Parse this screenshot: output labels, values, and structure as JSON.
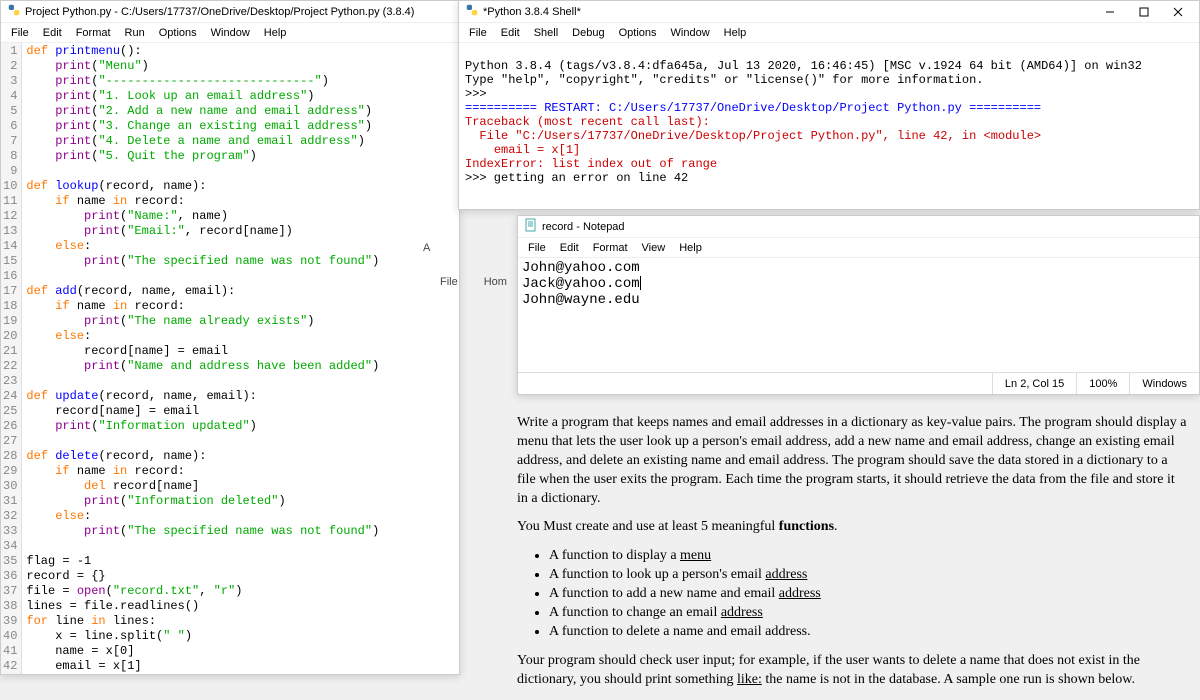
{
  "editor": {
    "title": "Project Python.py - C:/Users/17737/OneDrive/Desktop/Project Python.py (3.8.4)",
    "menu": [
      "File",
      "Edit",
      "Format",
      "Run",
      "Options",
      "Window",
      "Help"
    ],
    "code_lines": [
      {
        "n": 1,
        "tok": [
          [
            "kw",
            "def "
          ],
          [
            "def",
            "printmenu"
          ],
          [
            "",
            "():"
          ]
        ]
      },
      {
        "n": 2,
        "tok": [
          [
            "",
            "    "
          ],
          [
            "builtin",
            "print"
          ],
          [
            "",
            "("
          ],
          [
            "str",
            "\"Menu\""
          ],
          [
            "",
            ")"
          ]
        ]
      },
      {
        "n": 3,
        "tok": [
          [
            "",
            "    "
          ],
          [
            "builtin",
            "print"
          ],
          [
            "",
            "("
          ],
          [
            "str",
            "\"-----------------------------\""
          ],
          [
            "",
            ")"
          ]
        ]
      },
      {
        "n": 4,
        "tok": [
          [
            "",
            "    "
          ],
          [
            "builtin",
            "print"
          ],
          [
            "",
            "("
          ],
          [
            "str",
            "\"1. Look up an email address\""
          ],
          [
            "",
            ")"
          ]
        ]
      },
      {
        "n": 5,
        "tok": [
          [
            "",
            "    "
          ],
          [
            "builtin",
            "print"
          ],
          [
            "",
            "("
          ],
          [
            "str",
            "\"2. Add a new name and email address\""
          ],
          [
            "",
            ")"
          ]
        ]
      },
      {
        "n": 6,
        "tok": [
          [
            "",
            "    "
          ],
          [
            "builtin",
            "print"
          ],
          [
            "",
            "("
          ],
          [
            "str",
            "\"3. Change an existing email address\""
          ],
          [
            "",
            ")"
          ]
        ]
      },
      {
        "n": 7,
        "tok": [
          [
            "",
            "    "
          ],
          [
            "builtin",
            "print"
          ],
          [
            "",
            "("
          ],
          [
            "str",
            "\"4. Delete a name and email address\""
          ],
          [
            "",
            ")"
          ]
        ]
      },
      {
        "n": 8,
        "tok": [
          [
            "",
            "    "
          ],
          [
            "builtin",
            "print"
          ],
          [
            "",
            "("
          ],
          [
            "str",
            "\"5. Quit the program\""
          ],
          [
            "",
            ")"
          ]
        ]
      },
      {
        "n": 9,
        "tok": [
          [
            "",
            ""
          ]
        ]
      },
      {
        "n": 10,
        "tok": [
          [
            "kw",
            "def "
          ],
          [
            "def",
            "lookup"
          ],
          [
            "",
            "(record, name):"
          ]
        ]
      },
      {
        "n": 11,
        "tok": [
          [
            "",
            "    "
          ],
          [
            "kw",
            "if"
          ],
          [
            "",
            " name "
          ],
          [
            "kw",
            "in"
          ],
          [
            "",
            " record:"
          ]
        ]
      },
      {
        "n": 12,
        "tok": [
          [
            "",
            "        "
          ],
          [
            "builtin",
            "print"
          ],
          [
            "",
            "("
          ],
          [
            "str",
            "\"Name:\""
          ],
          [
            "",
            ", name)"
          ]
        ]
      },
      {
        "n": 13,
        "tok": [
          [
            "",
            "        "
          ],
          [
            "builtin",
            "print"
          ],
          [
            "",
            "("
          ],
          [
            "str",
            "\"Email:\""
          ],
          [
            "",
            ", record[name])"
          ]
        ]
      },
      {
        "n": 14,
        "tok": [
          [
            "",
            "    "
          ],
          [
            "kw",
            "else"
          ],
          [
            "",
            ":"
          ]
        ]
      },
      {
        "n": 15,
        "tok": [
          [
            "",
            "        "
          ],
          [
            "builtin",
            "print"
          ],
          [
            "",
            "("
          ],
          [
            "str",
            "\"The specified name was not found\""
          ],
          [
            "",
            ")"
          ]
        ]
      },
      {
        "n": 16,
        "tok": [
          [
            "",
            ""
          ]
        ]
      },
      {
        "n": 17,
        "tok": [
          [
            "kw",
            "def "
          ],
          [
            "def",
            "add"
          ],
          [
            "",
            "(record, name, email):"
          ]
        ]
      },
      {
        "n": 18,
        "tok": [
          [
            "",
            "    "
          ],
          [
            "kw",
            "if"
          ],
          [
            "",
            " name "
          ],
          [
            "kw",
            "in"
          ],
          [
            "",
            " record:"
          ]
        ]
      },
      {
        "n": 19,
        "tok": [
          [
            "",
            "        "
          ],
          [
            "builtin",
            "print"
          ],
          [
            "",
            "("
          ],
          [
            "str",
            "\"The name already exists\""
          ],
          [
            "",
            ")"
          ]
        ]
      },
      {
        "n": 20,
        "tok": [
          [
            "",
            "    "
          ],
          [
            "kw",
            "else"
          ],
          [
            "",
            ":"
          ]
        ]
      },
      {
        "n": 21,
        "tok": [
          [
            "",
            "        record[name] = email"
          ]
        ]
      },
      {
        "n": 22,
        "tok": [
          [
            "",
            "        "
          ],
          [
            "builtin",
            "print"
          ],
          [
            "",
            "("
          ],
          [
            "str",
            "\"Name and address have been added\""
          ],
          [
            "",
            ")"
          ]
        ]
      },
      {
        "n": 23,
        "tok": [
          [
            "",
            ""
          ]
        ]
      },
      {
        "n": 24,
        "tok": [
          [
            "kw",
            "def "
          ],
          [
            "def",
            "update"
          ],
          [
            "",
            "(record, name, email):"
          ]
        ]
      },
      {
        "n": 25,
        "tok": [
          [
            "",
            "    record[name] = email"
          ]
        ]
      },
      {
        "n": 26,
        "tok": [
          [
            "",
            "    "
          ],
          [
            "builtin",
            "print"
          ],
          [
            "",
            "("
          ],
          [
            "str",
            "\"Information updated\""
          ],
          [
            "",
            ")"
          ]
        ]
      },
      {
        "n": 27,
        "tok": [
          [
            "",
            ""
          ]
        ]
      },
      {
        "n": 28,
        "tok": [
          [
            "kw",
            "def "
          ],
          [
            "def",
            "delete"
          ],
          [
            "",
            "(record, name):"
          ]
        ]
      },
      {
        "n": 29,
        "tok": [
          [
            "",
            "    "
          ],
          [
            "kw",
            "if"
          ],
          [
            "",
            " name "
          ],
          [
            "kw",
            "in"
          ],
          [
            "",
            " record:"
          ]
        ]
      },
      {
        "n": 30,
        "tok": [
          [
            "",
            "        "
          ],
          [
            "kw",
            "del"
          ],
          [
            "",
            " record[name]"
          ]
        ]
      },
      {
        "n": 31,
        "tok": [
          [
            "",
            "        "
          ],
          [
            "builtin",
            "print"
          ],
          [
            "",
            "("
          ],
          [
            "str",
            "\"Information deleted\""
          ],
          [
            "",
            ")"
          ]
        ]
      },
      {
        "n": 32,
        "tok": [
          [
            "",
            "    "
          ],
          [
            "kw",
            "else"
          ],
          [
            "",
            ":"
          ]
        ]
      },
      {
        "n": 33,
        "tok": [
          [
            "",
            "        "
          ],
          [
            "builtin",
            "print"
          ],
          [
            "",
            "("
          ],
          [
            "str",
            "\"The specified name was not found\""
          ],
          [
            "",
            ")"
          ]
        ]
      },
      {
        "n": 34,
        "tok": [
          [
            "",
            ""
          ]
        ]
      },
      {
        "n": 35,
        "tok": [
          [
            "",
            "flag = -1"
          ]
        ]
      },
      {
        "n": 36,
        "tok": [
          [
            "",
            "record = {}"
          ]
        ]
      },
      {
        "n": 37,
        "tok": [
          [
            "",
            "file = "
          ],
          [
            "builtin",
            "open"
          ],
          [
            "",
            "("
          ],
          [
            "str",
            "\"record.txt\""
          ],
          [
            "",
            ", "
          ],
          [
            "str",
            "\"r\""
          ],
          [
            "",
            ")"
          ]
        ]
      },
      {
        "n": 38,
        "tok": [
          [
            "",
            "lines = file.readlines()"
          ]
        ]
      },
      {
        "n": 39,
        "tok": [
          [
            "kw",
            "for"
          ],
          [
            "",
            " line "
          ],
          [
            "kw",
            "in"
          ],
          [
            "",
            " lines:"
          ]
        ]
      },
      {
        "n": 40,
        "tok": [
          [
            "",
            "    x = line.split("
          ],
          [
            "str",
            "\" \""
          ],
          [
            "",
            ")"
          ]
        ]
      },
      {
        "n": 41,
        "tok": [
          [
            "",
            "    name = x[0]"
          ]
        ]
      },
      {
        "n": 42,
        "tok": [
          [
            "",
            "    email = x[1]"
          ]
        ]
      }
    ]
  },
  "shell": {
    "title": "*Python 3.8.4 Shell*",
    "menu": [
      "File",
      "Edit",
      "Shell",
      "Debug",
      "Options",
      "Window",
      "Help"
    ],
    "banner1": "Python 3.8.4 (tags/v3.8.4:dfa645a, Jul 13 2020, 16:46:45) [MSC v.1924 64 bit (AMD64)] on win32",
    "banner2": "Type \"help\", \"copyright\", \"credits\" or \"license()\" for more information.",
    "prompt": ">>>",
    "restart": "========== RESTART: C:/Users/17737/OneDrive/Desktop/Project Python.py ==========",
    "tb1": "Traceback (most recent call last):",
    "tb2": "  File \"C:/Users/17737/OneDrive/Desktop/Project Python.py\", line 42, in <module>",
    "tb3": "    email = x[1]",
    "tb4": "IndexError: list index out of range",
    "input": ">>> getting an error on line 42"
  },
  "notepad": {
    "title": "record - Notepad",
    "menu": [
      "File",
      "Edit",
      "Format",
      "View",
      "Help"
    ],
    "lines": [
      "John@yahoo.com",
      "Jack@yahoo.com",
      "John@wayne.edu"
    ],
    "status_pos": "Ln 2, Col 15",
    "status_zoom": "100%",
    "status_ending": "Windows"
  },
  "tabs": {
    "file": "File",
    "home": "Hom",
    "a": "A"
  },
  "assignment": {
    "p1": "Write a program that keeps names and email addresses in a dictionary as key-value pairs. The program should display a menu that lets the user look up a person's email address, add a new name and email address, change an existing email address, and delete an existing name and email address. The program should save the data stored in a dictionary to a file when the user exits the program. Each time the program starts, it should retrieve the data from the file and store it in a dictionary.",
    "p2a": "You Must create and use at least 5 meaningful ",
    "p2b": "functions",
    "p2c": ".",
    "li1a": "A function to display a ",
    "li1b": "menu",
    "li2a": "A function to look up a person's email ",
    "li2b": "address",
    "li3a": "A function to add a new name and email ",
    "li3b": "address",
    "li4a": "A function to change an email ",
    "li4b": "address",
    "li5": "A function to delete a name and email address.",
    "p3a": "Your program should check user input; for example, if the user wants to delete a name that does not exist in the dictionary, you should print something ",
    "p3b": "like:",
    "p3c": " the name is not in the database. A sample one run is shown below."
  }
}
